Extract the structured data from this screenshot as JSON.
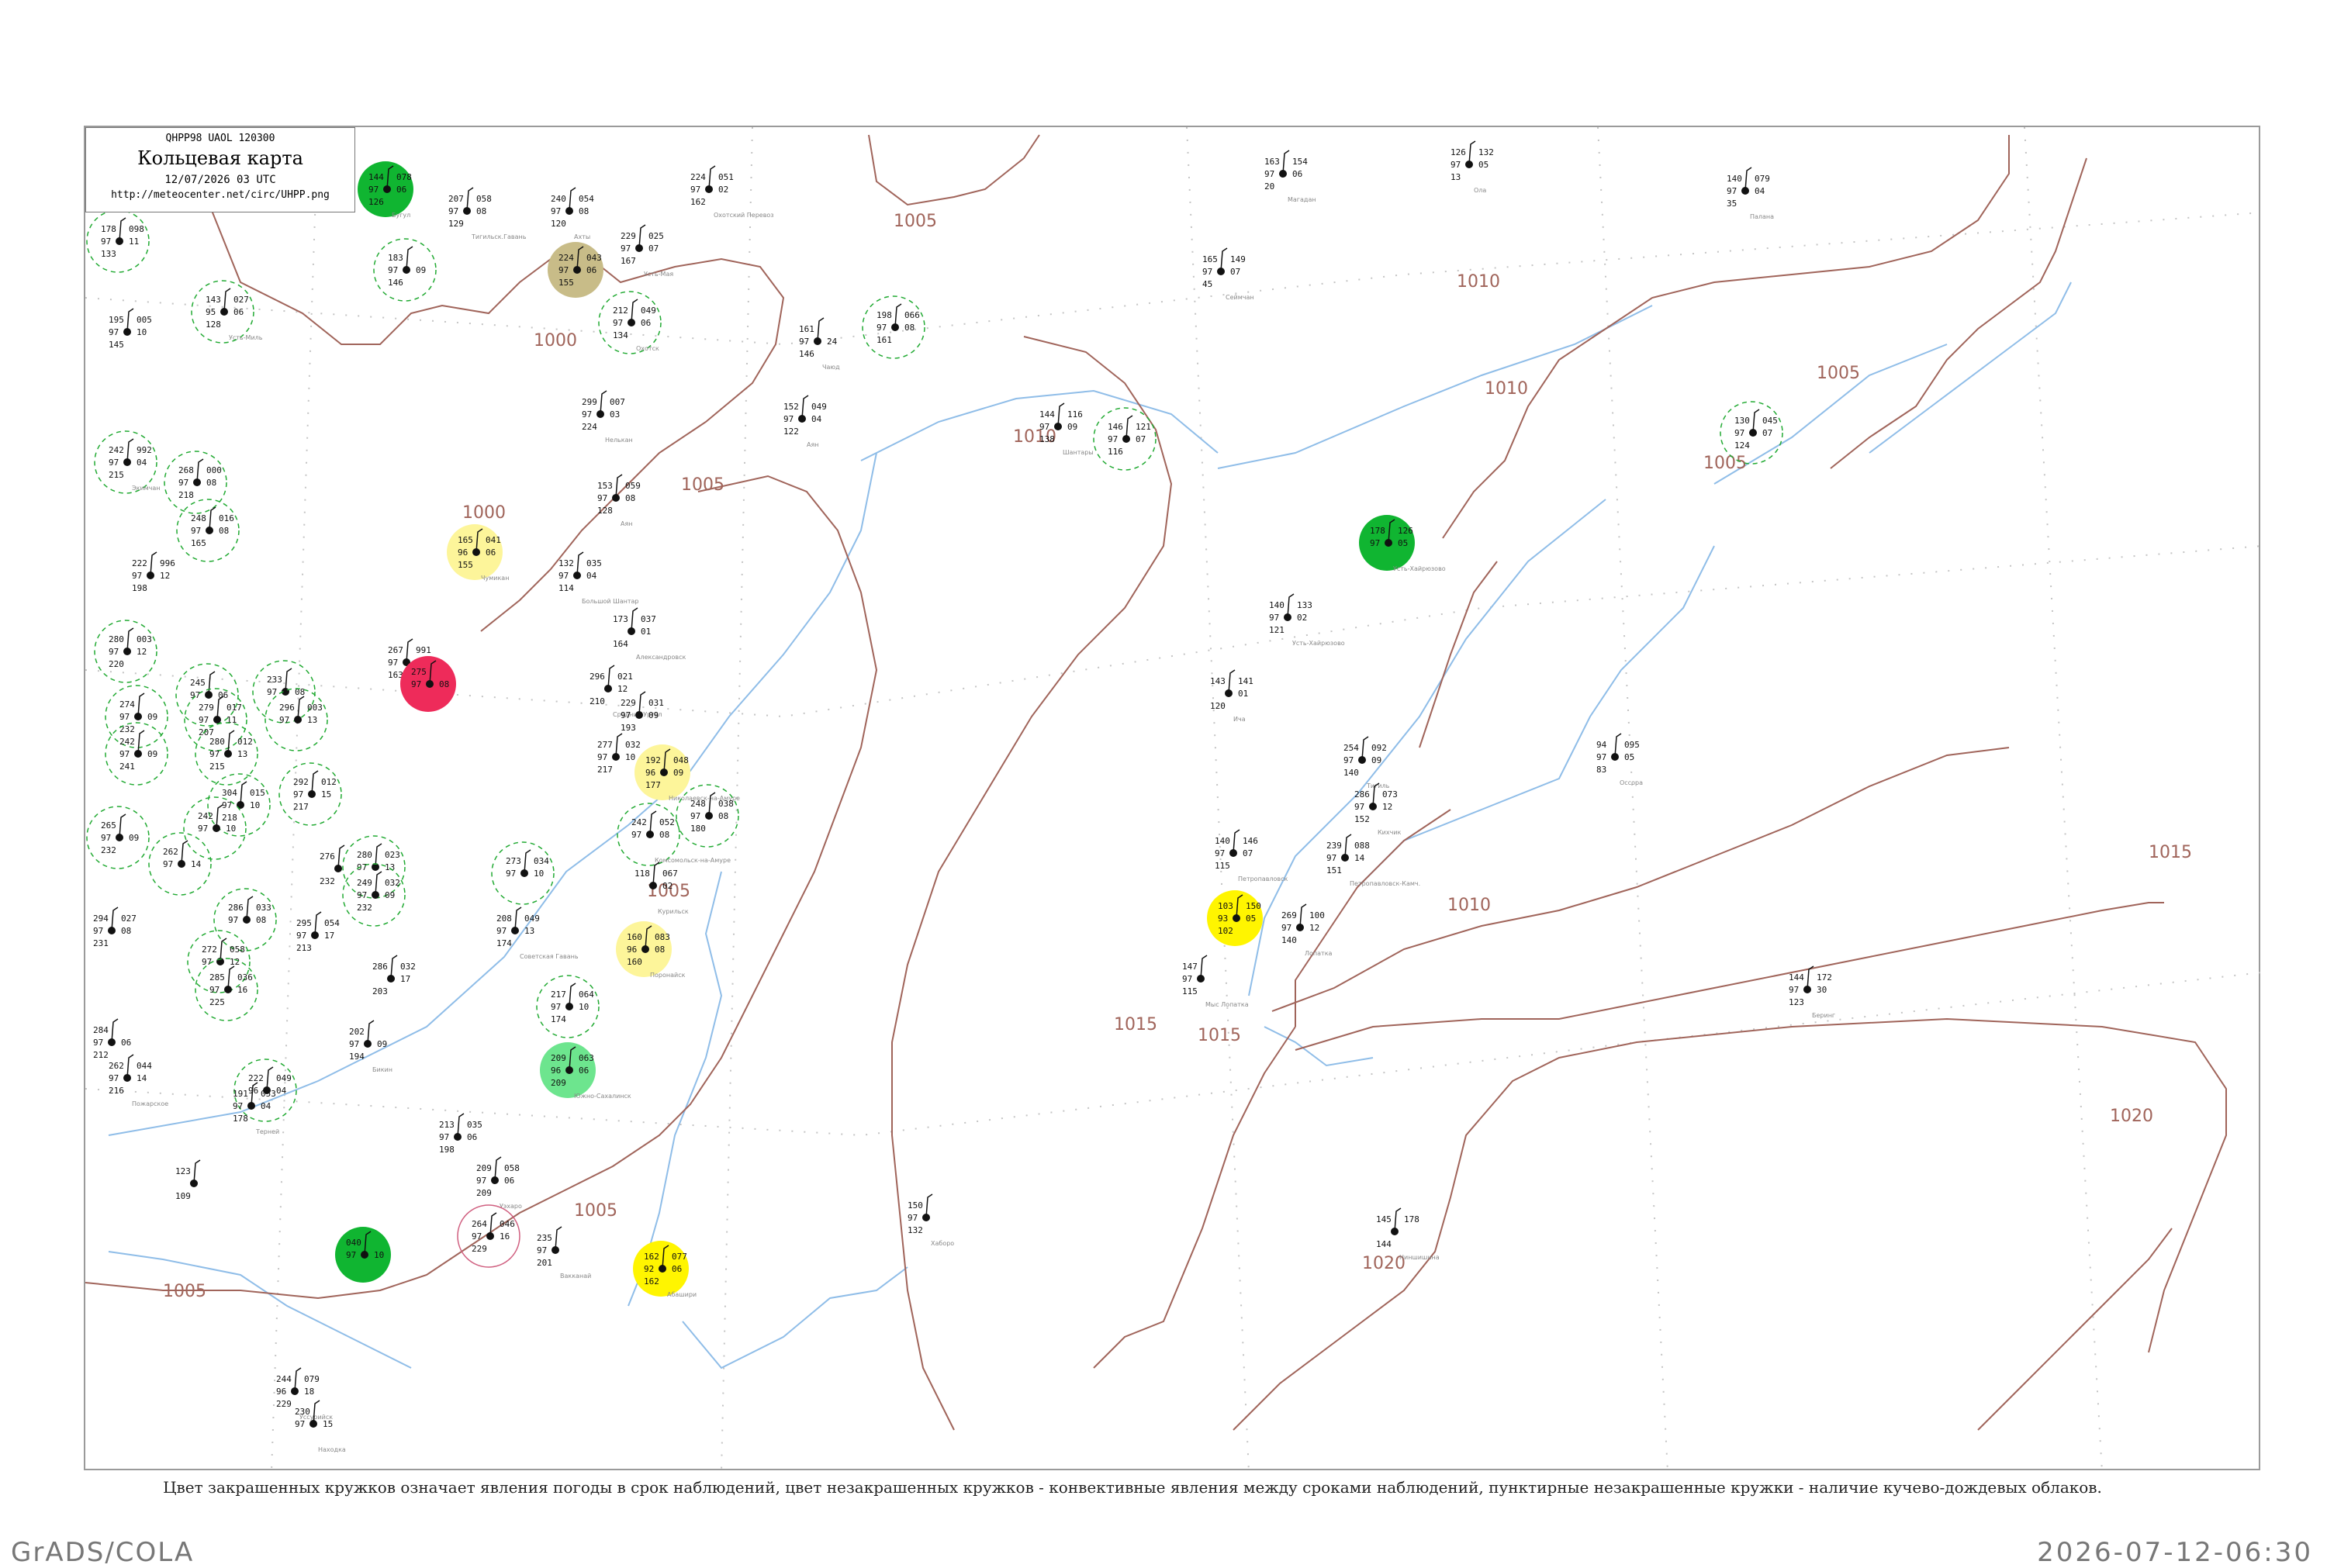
{
  "header": {
    "code": "QHPP98  UAOL  120300",
    "title": "Кольцевая карта",
    "datetime": "12/07/2026 03 UTC",
    "url": "http://meteocenter.net/circ/UHPP.png"
  },
  "caption": "Цвет закрашенных кружков означает явления погоды в срок наблюдений, цвет незакрашенных кружков - конвективные явления между сроками наблюдений, пунктирные незакрашенные кружки - наличие кучево-дождевых облаков.",
  "footer": {
    "left": "GrADS/COLA",
    "right": "2026-07-12-06:30"
  },
  "colors": {
    "isobar": "#a0645a",
    "coast": "#8fbde8",
    "station_green": "#10b531",
    "station_red": "#ee2b5a",
    "station_yellow": "#fff500",
    "station_paleyellow": "#fdf59a",
    "station_olive": "#c8bc88",
    "station_lightgreen": "#6de58e",
    "cb_circle": "#22aa33"
  },
  "map": {
    "isobar_labels": [
      "1005",
      "1000",
      "1010",
      "1005",
      "1010",
      "1005",
      "1010",
      "1005",
      "1000",
      "1005",
      "1010",
      "1015",
      "1015",
      "1015",
      "1005",
      "1020",
      "1005",
      "1020"
    ],
    "stations": [
      {
        "a": "178",
        "b": "098",
        "c": "97",
        "d": "11",
        "e": "133",
        "name": ""
      },
      {
        "a": "144",
        "b": "078",
        "c": "97",
        "d": "06",
        "e": "126",
        "name": "Бугул"
      },
      {
        "a": "207",
        "b": "058",
        "c": "97",
        "d": "08",
        "e": "129",
        "name": "Тигильск.Гавань"
      },
      {
        "a": "240",
        "b": "054",
        "c": "97",
        "d": "08",
        "e": "120",
        "name": "Ахты"
      },
      {
        "a": "224",
        "b": "051",
        "c": "97",
        "d": "02",
        "e": "162",
        "name": "Охотский Перевоз"
      },
      {
        "a": "183",
        "b": "",
        "c": "97",
        "d": "09",
        "e": "146",
        "name": ""
      },
      {
        "a": "224",
        "b": "043",
        "c": "97",
        "d": "06",
        "e": "155",
        "name": ""
      },
      {
        "a": "229",
        "b": "025",
        "c": "97",
        "d": "07",
        "e": "167",
        "name": "Усть-Мая"
      },
      {
        "a": "143",
        "b": "027",
        "c": "95",
        "d": "06",
        "e": "128",
        "name": "Усть-Миль"
      },
      {
        "a": "195",
        "b": "005",
        "c": "97",
        "d": "10",
        "e": "145",
        "name": ""
      },
      {
        "a": "212",
        "b": "049",
        "c": "97",
        "d": "06",
        "e": "134",
        "name": "Охотск"
      },
      {
        "a": "198",
        "b": "066",
        "c": "97",
        "d": "08",
        "e": "161",
        "name": ""
      },
      {
        "a": "161",
        "b": "",
        "c": "97",
        "d": "24",
        "e": "146",
        "name": "Чаюд"
      },
      {
        "a": "163",
        "b": "154",
        "c": "97",
        "d": "06",
        "e": "20",
        "name": "Магадан"
      },
      {
        "a": "126",
        "b": "132",
        "c": "97",
        "d": "05",
        "e": "13",
        "name": "Ола"
      },
      {
        "a": "140",
        "b": "079",
        "c": "97",
        "d": "04",
        "e": "35",
        "name": "Палана"
      },
      {
        "a": "165",
        "b": "149",
        "c": "97",
        "d": "07",
        "e": "45",
        "name": "Сеймчан"
      },
      {
        "a": "299",
        "b": "007",
        "c": "97",
        "d": "03",
        "e": "224",
        "name": "Нелькан"
      },
      {
        "a": "152",
        "b": "049",
        "c": "97",
        "d": "04",
        "e": "122",
        "name": "Аян"
      },
      {
        "a": "144",
        "b": "116",
        "c": "97",
        "d": "09",
        "e": "138",
        "name": "Шантары"
      },
      {
        "a": "146",
        "b": "121",
        "c": "97",
        "d": "07",
        "e": "116",
        "name": ""
      },
      {
        "a": "130",
        "b": "045",
        "c": "97",
        "d": "07",
        "e": "124",
        "name": ""
      },
      {
        "a": "242",
        "b": "992",
        "c": "97",
        "d": "04",
        "e": "215",
        "name": "Экимчан"
      },
      {
        "a": "268",
        "b": "000",
        "c": "97",
        "d": "08",
        "e": "218",
        "name": ""
      },
      {
        "a": "153",
        "b": "059",
        "c": "97",
        "d": "08",
        "e": "128",
        "name": "Аян"
      },
      {
        "a": "248",
        "b": "016",
        "c": "97",
        "d": "08",
        "e": "165",
        "name": ""
      },
      {
        "a": "165",
        "b": "041",
        "c": "96",
        "d": "06",
        "e": "155",
        "name": "Чумикан"
      },
      {
        "a": "132",
        "b": "035",
        "c": "97",
        "d": "04",
        "e": "114",
        "name": "Большой Шантар"
      },
      {
        "a": "178",
        "b": "126",
        "c": "97",
        "d": "05",
        "e": "",
        "name": "Усть-Хайрюзово"
      },
      {
        "a": "222",
        "b": "996",
        "c": "97",
        "d": "12",
        "e": "198",
        "name": ""
      },
      {
        "a": "173",
        "b": "037",
        "c": "",
        "d": "01",
        "e": "164",
        "name": "Александровск"
      },
      {
        "a": "140",
        "b": "133",
        "c": "97",
        "d": "02",
        "e": "121",
        "name": "Усть-Хайрюзово"
      },
      {
        "a": "280",
        "b": "003",
        "c": "97",
        "d": "12",
        "e": "220",
        "name": ""
      },
      {
        "a": "267",
        "b": "991",
        "c": "97",
        "d": "04",
        "e": "163",
        "name": ""
      },
      {
        "a": "275",
        "b": "",
        "c": "97",
        "d": "08",
        "e": "",
        "name": ""
      },
      {
        "a": "296",
        "b": "021",
        "c": "",
        "d": "12",
        "e": "210",
        "name": "Средний Ургал"
      },
      {
        "a": "229",
        "b": "031",
        "c": "97",
        "d": "09",
        "e": "193",
        "name": ""
      },
      {
        "a": "143",
        "b": "141",
        "c": "",
        "d": "01",
        "e": "120",
        "name": "Ича"
      },
      {
        "a": "245",
        "b": "",
        "c": "97",
        "d": "06",
        "e": "",
        "name": ""
      },
      {
        "a": "233",
        "b": "",
        "c": "97",
        "d": "08",
        "e": "",
        "name": ""
      },
      {
        "a": "274",
        "b": "",
        "c": "97",
        "d": "09",
        "e": "232",
        "name": ""
      },
      {
        "a": "279",
        "b": "017",
        "c": "97",
        "d": "11",
        "e": "207",
        "name": ""
      },
      {
        "a": "296",
        "b": "003",
        "c": "97",
        "d": "13",
        "e": "",
        "name": ""
      },
      {
        "a": "242",
        "b": "",
        "c": "97",
        "d": "09",
        "e": "241",
        "name": ""
      },
      {
        "a": "280",
        "b": "012",
        "c": "97",
        "d": "13",
        "e": "215",
        "name": ""
      },
      {
        "a": "277",
        "b": "032",
        "c": "97",
        "d": "10",
        "e": "217",
        "name": ""
      },
      {
        "a": "192",
        "b": "048",
        "c": "96",
        "d": "09",
        "e": "177",
        "name": "Николаевск-на-Амуре"
      },
      {
        "a": "254",
        "b": "092",
        "c": "97",
        "d": "09",
        "e": "140",
        "name": "Тигиль"
      },
      {
        "a": "94",
        "b": "095",
        "c": "97",
        "d": "05",
        "e": "83",
        "name": "Оссора"
      },
      {
        "a": "292",
        "b": "012",
        "c": "97",
        "d": "15",
        "e": "217",
        "name": ""
      },
      {
        "a": "304",
        "b": "015",
        "c": "97",
        "d": "10",
        "e": "218",
        "name": ""
      },
      {
        "a": "248",
        "b": "038",
        "c": "97",
        "d": "08",
        "e": "180",
        "name": ""
      },
      {
        "a": "286",
        "b": "073",
        "c": "97",
        "d": "12",
        "e": "152",
        "name": "Кихчик"
      },
      {
        "a": "265",
        "b": "",
        "c": "97",
        "d": "09",
        "e": "232",
        "name": ""
      },
      {
        "a": "242",
        "b": "",
        "c": "97",
        "d": "10",
        "e": "",
        "name": ""
      },
      {
        "a": "242",
        "b": "052",
        "c": "97",
        "d": "08",
        "e": "",
        "name": "Комсомольск-на-Амуре"
      },
      {
        "a": "140",
        "b": "146",
        "c": "97",
        "d": "07",
        "e": "115",
        "name": "Петропавловск"
      },
      {
        "a": "239",
        "b": "088",
        "c": "97",
        "d": "14",
        "e": "151",
        "name": "Петропавловск-Камч."
      },
      {
        "a": "262",
        "b": "",
        "c": "97",
        "d": "14",
        "e": "",
        "name": ""
      },
      {
        "a": "276",
        "b": "",
        "c": "",
        "d": "",
        "e": "232",
        "name": ""
      },
      {
        "a": "280",
        "b": "023",
        "c": "97",
        "d": "13",
        "e": "",
        "name": ""
      },
      {
        "a": "273",
        "b": "034",
        "c": "97",
        "d": "10",
        "e": "",
        "name": ""
      },
      {
        "a": "249",
        "b": "032",
        "c": "97",
        "d": "09",
        "e": "232",
        "name": ""
      },
      {
        "a": "118",
        "b": "067",
        "c": "",
        "d": "02",
        "e": "",
        "name": "Курильск"
      },
      {
        "a": "269",
        "b": "100",
        "c": "97",
        "d": "12",
        "e": "140",
        "name": "Лопатка"
      },
      {
        "a": "286",
        "b": "033",
        "c": "97",
        "d": "08",
        "e": "",
        "name": ""
      },
      {
        "a": "294",
        "b": "027",
        "c": "97",
        "d": "08",
        "e": "231",
        "name": ""
      },
      {
        "a": "295",
        "b": "054",
        "c": "97",
        "d": "17",
        "e": "213",
        "name": ""
      },
      {
        "a": "208",
        "b": "049",
        "c": "97",
        "d": "13",
        "e": "174",
        "name": "Советская Гавань"
      },
      {
        "a": "103",
        "b": "150",
        "c": "93",
        "d": "05",
        "e": "102",
        "name": ""
      },
      {
        "a": "272",
        "b": "058",
        "c": "97",
        "d": "12",
        "e": "",
        "name": ""
      },
      {
        "a": "160",
        "b": "083",
        "c": "96",
        "d": "08",
        "e": "160",
        "name": "Поронайск"
      },
      {
        "a": "147",
        "b": "",
        "c": "97",
        "d": "",
        "e": "115",
        "name": "Мыс Лопатка"
      },
      {
        "a": "285",
        "b": "036",
        "c": "97",
        "d": "16",
        "e": "225",
        "name": ""
      },
      {
        "a": "286",
        "b": "032",
        "c": "",
        "d": "17",
        "e": "203",
        "name": ""
      },
      {
        "a": "144",
        "b": "172",
        "c": "97",
        "d": "30",
        "e": "123",
        "name": "Беринг"
      },
      {
        "a": "217",
        "b": "064",
        "c": "97",
        "d": "10",
        "e": "174",
        "name": ""
      },
      {
        "a": "284",
        "b": "",
        "c": "97",
        "d": "06",
        "e": "212",
        "name": ""
      },
      {
        "a": "202",
        "b": "",
        "c": "97",
        "d": "09",
        "e": "194",
        "name": "Бикин"
      },
      {
        "a": "209",
        "b": "063",
        "c": "96",
        "d": "06",
        "e": "209",
        "name": "Южно-Сахалинск"
      },
      {
        "a": "262",
        "b": "044",
        "c": "97",
        "d": "14",
        "e": "216",
        "name": "Пожарское"
      },
      {
        "a": "222",
        "b": "049",
        "c": "96",
        "d": "04",
        "e": "",
        "name": ""
      },
      {
        "a": "191",
        "b": "053",
        "c": "97",
        "d": "04",
        "e": "178",
        "name": "Терней"
      },
      {
        "a": "213",
        "b": "035",
        "c": "97",
        "d": "06",
        "e": "198",
        "name": ""
      },
      {
        "a": "123",
        "b": "",
        "c": "",
        "d": "",
        "e": "109",
        "name": ""
      },
      {
        "a": "209",
        "b": "058",
        "c": "97",
        "d": "06",
        "e": "209",
        "name": "Уэхаро"
      },
      {
        "a": "264",
        "b": "046",
        "c": "97",
        "d": "16",
        "e": "229",
        "name": ""
      },
      {
        "a": "145",
        "b": "178",
        "c": "",
        "d": "",
        "e": "144",
        "name": "Ниншишина"
      },
      {
        "a": "150",
        "b": "",
        "c": "97",
        "d": "",
        "e": "132",
        "name": "Хаборо"
      },
      {
        "a": "235",
        "b": "",
        "c": "97",
        "d": "",
        "e": "201",
        "name": "Вакканай"
      },
      {
        "a": "162",
        "b": "077",
        "c": "92",
        "d": "06",
        "e": "162",
        "name": "Абашири"
      },
      {
        "a": "040",
        "b": "",
        "c": "97",
        "d": "10",
        "e": "",
        "name": ""
      },
      {
        "a": "244",
        "b": "079",
        "c": "96",
        "d": "18",
        "e": "229",
        "name": "Уссурийск"
      },
      {
        "a": "230",
        "b": "",
        "c": "97",
        "d": "15",
        "e": "",
        "name": "Находка"
      }
    ]
  }
}
